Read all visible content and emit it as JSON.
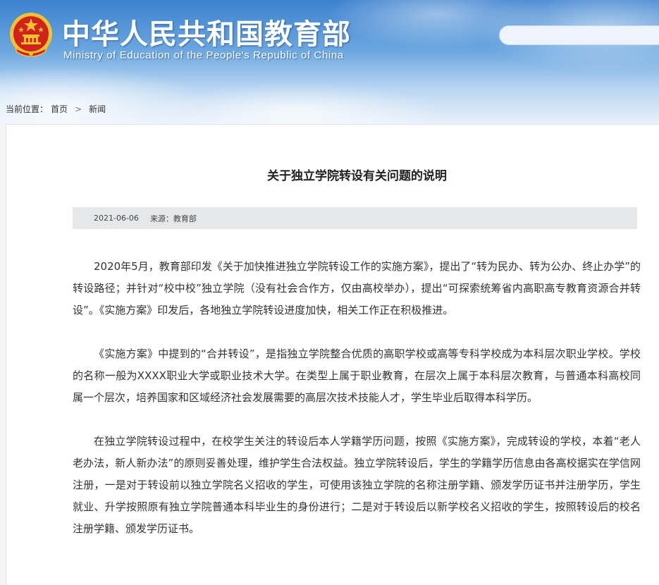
{
  "header": {
    "title_cn": "中华人民共和国教育部",
    "title_en": "Ministry of Education of the People's Republic of China",
    "emblem_icon": "national-emblem-icon",
    "search_placeholder": ""
  },
  "breadcrumb": {
    "label": "当前位置：",
    "items": [
      "首页",
      "新闻"
    ],
    "separator": ">"
  },
  "article": {
    "title": "关于独立学院转设有关问题的说明",
    "date": "2021-06-06",
    "source": "来源：教育部",
    "paragraphs": [
      "2020年5月，教育部印发《关于加快推进独立学院转设工作的实施方案》，提出了“转为民办、转为公办、终止办学”的转设路径；并针对“校中校”独立学院（没有社会合作方，仅由高校举办），提出“可探索统筹省内高职高专教育资源合并转设”。《实施方案》印发后，各地独立学院转设进度加快，相关工作正在积极推进。",
      "《实施方案》中提到的“合并转设”，是指独立学院整合优质的高职学校或高等专科学校成为本科层次职业学校。学校的名称一般为XXXX职业大学或职业技术大学。在类型上属于职业教育，在层次上属于本科层次教育，与普通本科高校同属一个层次，培养国家和区域经济社会发展需要的高层次技术技能人才，学生毕业后取得本科学历。",
      "在独立学院转设过程中，在校学生关注的转设后本人学籍学历问题，按照《实施方案》，完成转设的学校，本着“老人老办法，新人新办法”的原则妥善处理，维护学生合法权益。独立学院转设后，学生的学籍学历信息由各高校据实在学信网注册，一是对于转设前以独立学院名义招收的学生，可使用该独立学院的名称注册学籍、颁发学历证书并注册学历，学生就业、升学按照原有独立学院普通本科毕业生的身份进行；二是对于转设后以新学校名义招收的学生，按照转设后的校名注册学籍、颁发学历证书。"
    ]
  },
  "colors": {
    "header_blue": "#3d82cf",
    "emblem_red": "#d2231b",
    "emblem_gold": "#f2c230",
    "meta_bar_bg": "#e6e7e9",
    "text": "#333333"
  }
}
